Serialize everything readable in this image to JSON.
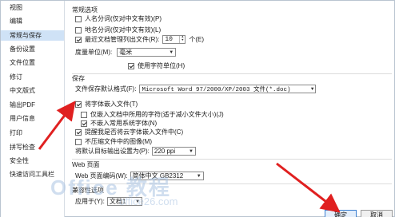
{
  "sidebar": {
    "items": [
      {
        "label": "视图"
      },
      {
        "label": "编辑"
      },
      {
        "label": "常规与保存",
        "active": true
      },
      {
        "label": "备份设置"
      },
      {
        "label": "文件位置"
      },
      {
        "label": "修订"
      },
      {
        "label": "中文版式"
      },
      {
        "label": "输出PDF"
      },
      {
        "label": "用户信息"
      },
      {
        "label": "打印"
      },
      {
        "label": "拼写检查"
      },
      {
        "label": "安全性"
      },
      {
        "label": "快速访问工具栏"
      }
    ]
  },
  "general": {
    "title": "常规选项",
    "opt_person": "人名分词(仅对中文有效)(P)",
    "opt_place": "地名分词(仅对中文有效)(L)",
    "opt_recent_prefix": "最近文档管理列出文件(R):",
    "recent_value": "10",
    "opt_recent_suffix": "个(E)",
    "measure_label": "度量单位(M):",
    "measure_value": "毫米",
    "use_char_unit": "使用字符单位(H)"
  },
  "save": {
    "title": "保存",
    "default_format_label": "文件保存默认格式(F):",
    "default_format_value": "Microsoft Word 97/2000/XP/2003 文件(*.doc)",
    "embed_fonts": "将字体嵌入文件(T)",
    "embed_only_used": "仅嵌入文档中所用的字符(适于减小文件大小)(J)",
    "no_common_fonts": "不嵌入常用系统字体(N)",
    "cloud_fonts": "提醒我是否将云字体嵌入文件中(C)",
    "no_compress": "不压缩文件中的图像(M)",
    "target_label": "将默认目标输出设置为(P):",
    "target_value": "220 ppi"
  },
  "web": {
    "title": "Web 页面",
    "encoding_label": "Web 页面编码(W):",
    "encoding_value": "简体中文 GB2312"
  },
  "compat": {
    "title": "兼容性选项",
    "apply_label": "应用于(Y):",
    "apply_value": "文档1"
  },
  "buttons": {
    "ok": "确定",
    "cancel": "取消"
  },
  "watermark": {
    "text": "Office 教程",
    "sub": "office26.com"
  },
  "colors": {
    "accent": "#3b7fd0",
    "selection": "#cfe2f6",
    "arrow": "#e02020"
  }
}
